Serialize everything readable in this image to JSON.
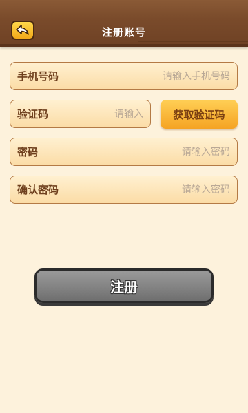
{
  "header": {
    "title": "注册账号",
    "back_icon": "back-arrow-icon"
  },
  "form": {
    "phone": {
      "label": "手机号码",
      "placeholder": "请输入手机号码",
      "value": ""
    },
    "code": {
      "label": "验证码",
      "placeholder": "请输入",
      "value": ""
    },
    "get_code_label": "获取验证码",
    "password": {
      "label": "密码",
      "placeholder": "请输入密码",
      "value": ""
    },
    "confirm_password": {
      "label": "确认密码",
      "placeholder": "请输入密码",
      "value": ""
    }
  },
  "register_label": "注册",
  "colors": {
    "background": "#fdf2dc",
    "header_wood": "#7a4b2b",
    "field_border": "#b47a45",
    "label_text": "#6e3f1d",
    "accent_orange": "#f5a323",
    "register_gray": "#838383"
  }
}
